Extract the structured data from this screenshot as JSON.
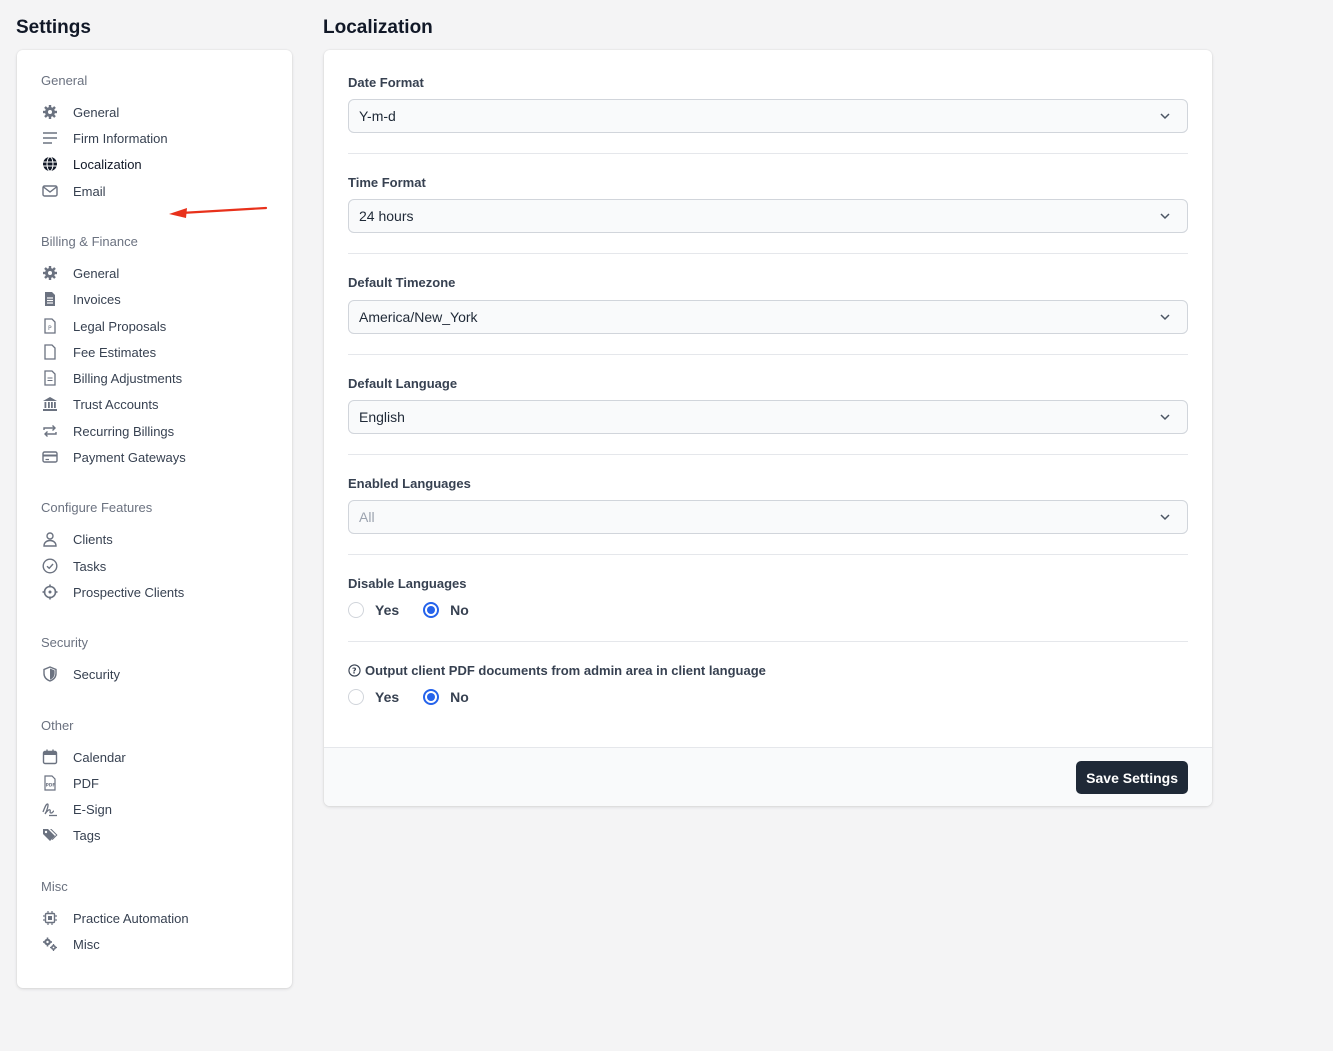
{
  "settings_title": "Settings",
  "section_title": "Localization",
  "sidebar": {
    "groups": [
      {
        "title": "General",
        "items": [
          {
            "label": "General",
            "icon": "gear-icon"
          },
          {
            "label": "Firm Information",
            "icon": "menu-lines-icon"
          },
          {
            "label": "Localization",
            "icon": "globe-icon",
            "active": true
          },
          {
            "label": "Email",
            "icon": "envelope-icon"
          }
        ]
      },
      {
        "title": "Billing & Finance",
        "items": [
          {
            "label": "General",
            "icon": "gear-icon"
          },
          {
            "label": "Invoices",
            "icon": "invoice-icon"
          },
          {
            "label": "Legal Proposals",
            "icon": "proposal-doc-icon"
          },
          {
            "label": "Fee Estimates",
            "icon": "blank-doc-icon"
          },
          {
            "label": "Billing Adjustments",
            "icon": "lined-doc-icon"
          },
          {
            "label": "Trust Accounts",
            "icon": "bank-icon"
          },
          {
            "label": "Recurring Billings",
            "icon": "repeat-icon"
          },
          {
            "label": "Payment Gateways",
            "icon": "credit-card-icon"
          }
        ]
      },
      {
        "title": "Configure Features",
        "items": [
          {
            "label": "Clients",
            "icon": "user-icon"
          },
          {
            "label": "Tasks",
            "icon": "check-circle-icon"
          },
          {
            "label": "Prospective Clients",
            "icon": "crosshair-icon"
          }
        ]
      },
      {
        "title": "Security",
        "items": [
          {
            "label": "Security",
            "icon": "shield-icon"
          }
        ]
      },
      {
        "title": "Other",
        "items": [
          {
            "label": "Calendar",
            "icon": "calendar-icon"
          },
          {
            "label": "PDF",
            "icon": "pdf-icon"
          },
          {
            "label": "E-Sign",
            "icon": "signature-icon"
          },
          {
            "label": "Tags",
            "icon": "tags-icon"
          }
        ]
      },
      {
        "title": "Misc",
        "items": [
          {
            "label": "Practice Automation",
            "icon": "chip-icon"
          },
          {
            "label": "Misc",
            "icon": "gears-icon"
          }
        ]
      }
    ]
  },
  "form": {
    "date_format": {
      "label": "Date Format",
      "value": "Y-m-d"
    },
    "time_format": {
      "label": "Time Format",
      "value": "24 hours"
    },
    "default_timezone": {
      "label": "Default Timezone",
      "value": "America/New_York"
    },
    "default_language": {
      "label": "Default Language",
      "value": "English"
    },
    "enabled_languages": {
      "label": "Enabled Languages",
      "placeholder": "All"
    },
    "disable_languages": {
      "label": "Disable Languages",
      "yes": "Yes",
      "no": "No",
      "selected": "No"
    },
    "output_pdf_language": {
      "label": "Output client PDF documents from admin area in client language",
      "yes": "Yes",
      "no": "No",
      "selected": "No"
    }
  },
  "footer": {
    "save_label": "Save Settings"
  },
  "colors": {
    "accent": "#2563eb",
    "button": "#1f2937",
    "annotation": "#e8311b"
  }
}
